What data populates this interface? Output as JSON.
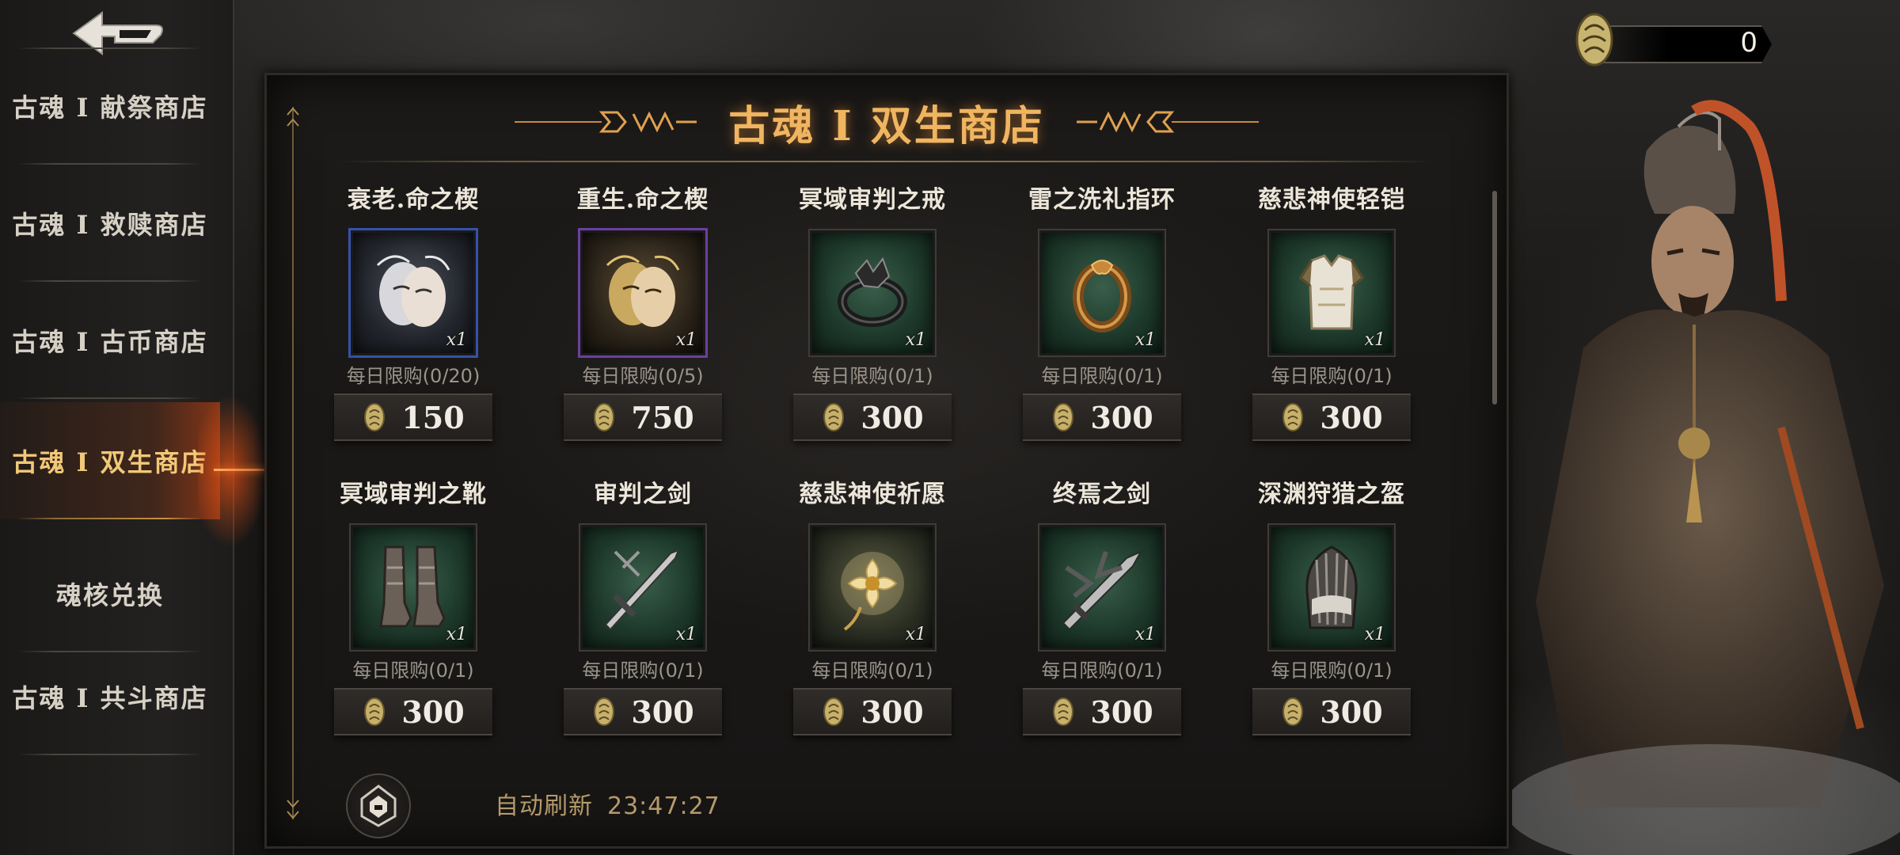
{
  "sidebar": {
    "items": [
      {
        "label": "古魂 I 献祭商店",
        "active": false
      },
      {
        "label": "古魂 I 救赎商店",
        "active": false
      },
      {
        "label": "古魂 I 古币商店",
        "active": false
      },
      {
        "label": "古魂 I 双生商店",
        "active": true
      },
      {
        "label": "魂核兑换",
        "active": false
      },
      {
        "label": "古魂 I 共斗商店",
        "active": false
      }
    ]
  },
  "panel": {
    "title": "古魂 I 双生商店"
  },
  "currency": {
    "value": "0",
    "icon": "coin-icon"
  },
  "items": [
    {
      "name": "衰老.命之楔",
      "limit": "每日限购(0/20)",
      "price": "150",
      "qty": "x1",
      "rarity": "blue",
      "icon": "mask-icon"
    },
    {
      "name": "重生.命之楔",
      "limit": "每日限购(0/5)",
      "price": "750",
      "qty": "x1",
      "rarity": "purple",
      "icon": "mask-icon"
    },
    {
      "name": "冥域审判之戒",
      "limit": "每日限购(0/1)",
      "price": "300",
      "qty": "x1",
      "rarity": "green",
      "icon": "ring-icon"
    },
    {
      "name": "雷之洗礼指环",
      "limit": "每日限购(0/1)",
      "price": "300",
      "qty": "x1",
      "rarity": "green",
      "icon": "ring-icon"
    },
    {
      "name": "慈悲神使轻铠",
      "limit": "每日限购(0/1)",
      "price": "300",
      "qty": "x1",
      "rarity": "green",
      "icon": "armor-icon"
    },
    {
      "name": "冥域审判之靴",
      "limit": "每日限购(0/1)",
      "price": "300",
      "qty": "x1",
      "rarity": "green",
      "icon": "boots-icon"
    },
    {
      "name": "审判之剑",
      "limit": "每日限购(0/1)",
      "price": "300",
      "qty": "x1",
      "rarity": "green",
      "icon": "sword-icon"
    },
    {
      "name": "慈悲神使祈愿",
      "limit": "每日限购(0/1)",
      "price": "300",
      "qty": "x1",
      "rarity": "green",
      "icon": "flower-icon"
    },
    {
      "name": "终焉之剑",
      "limit": "每日限购(0/1)",
      "price": "300",
      "qty": "x1",
      "rarity": "green",
      "icon": "sword-icon"
    },
    {
      "name": "深渊狩猎之盔",
      "limit": "每日限购(0/1)",
      "price": "300",
      "qty": "x1",
      "rarity": "green",
      "icon": "helmet-icon"
    }
  ],
  "refresh": {
    "label": "自动刷新",
    "time": "23:47:27"
  },
  "colors": {
    "accent": "#f0b560",
    "active_nav": "#f1c878",
    "rarity_blue": "#3552a8",
    "rarity_purple": "#6c3fa0",
    "rarity_green": "#1e3a2c"
  }
}
